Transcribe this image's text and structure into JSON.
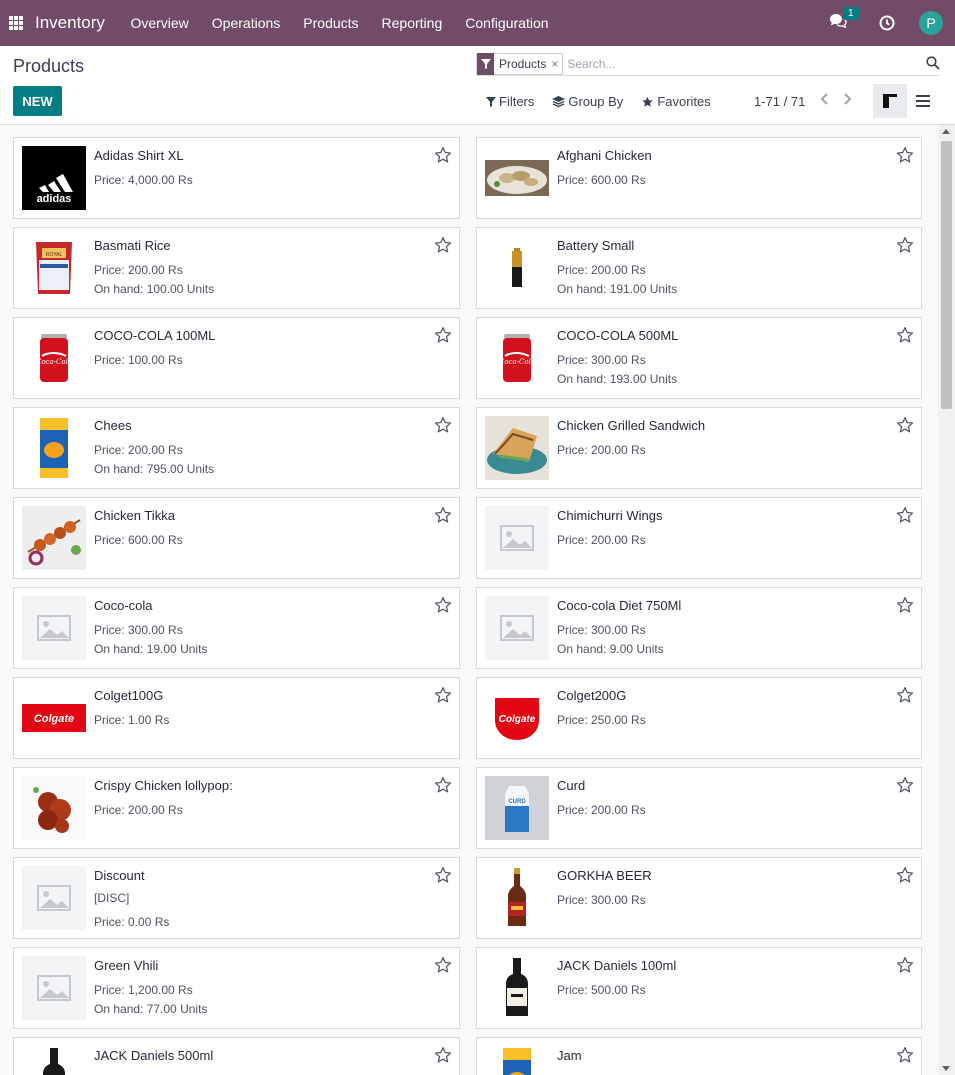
{
  "navbar": {
    "brand": "Inventory",
    "menu": [
      "Overview",
      "Operations",
      "Products",
      "Reporting",
      "Configuration"
    ],
    "chat_count": "1",
    "avatar_letter": "P",
    "color": "#714b67"
  },
  "control": {
    "title": "Products",
    "new_label": "NEW",
    "facet_value": "Products",
    "facet_close": "×",
    "search_placeholder": "Search...",
    "filters_label": "Filters",
    "groupby_label": "Group By",
    "favorites_label": "Favorites",
    "pager": "1-71 / 71",
    "active_view": "kanban"
  },
  "products": [
    {
      "name": "Adidas Shirt XL",
      "lines": [
        "Price: 4,000.00 Rs"
      ],
      "image": "adidas-logo"
    },
    {
      "name": "Afghani Chicken",
      "lines": [
        "Price: 600.00 Rs"
      ],
      "image": "food-plate"
    },
    {
      "name": "Basmati Rice",
      "lines": [
        "Price: 200.00 Rs",
        "On hand: 100.00 Units"
      ],
      "image": "rice-bag"
    },
    {
      "name": "Battery Small",
      "lines": [
        "Price: 200.00 Rs",
        "On hand: 191.00 Units"
      ],
      "image": "battery"
    },
    {
      "name": "COCO-COLA 100ML",
      "lines": [
        "Price: 100.00 Rs"
      ],
      "image": "cola-can"
    },
    {
      "name": "COCO-COLA 500ML",
      "lines": [
        "Price: 300.00 Rs",
        "On hand: 193.00 Units"
      ],
      "image": "cola-can"
    },
    {
      "name": "Chees",
      "lines": [
        "Price: 200.00 Rs",
        "On hand: 795.00 Units"
      ],
      "image": "cheese-box"
    },
    {
      "name": "Chicken Grilled Sandwich",
      "lines": [
        "Price: 200.00 Rs"
      ],
      "image": "sandwich"
    },
    {
      "name": "Chicken Tikka",
      "lines": [
        "Price: 600.00 Rs"
      ],
      "image": "tikka"
    },
    {
      "name": "Chimichurri Wings",
      "lines": [
        "Price: 200.00 Rs"
      ],
      "image": "placeholder"
    },
    {
      "name": "Coco-cola",
      "lines": [
        "Price: 300.00 Rs",
        "On hand: 19.00 Units"
      ],
      "image": "placeholder"
    },
    {
      "name": "Coco-cola Diet 750Ml",
      "lines": [
        "Price: 300.00 Rs",
        "On hand: 9.00 Units"
      ],
      "image": "placeholder"
    },
    {
      "name": "Colget100G",
      "lines": [
        "Price: 1.00 Rs"
      ],
      "image": "colgate-wide"
    },
    {
      "name": "Colget200G",
      "lines": [
        "Price: 250.00 Rs"
      ],
      "image": "colgate-round"
    },
    {
      "name": "Crispy Chicken lollypop:",
      "lines": [
        "Price: 200.00 Rs"
      ],
      "image": "lollypop"
    },
    {
      "name": "Curd",
      "lines": [
        "Price: 200.00 Rs"
      ],
      "image": "curd-carton"
    },
    {
      "name": "Discount",
      "lines": [
        "[DISC]",
        "Price: 0.00 Rs"
      ],
      "image": "placeholder"
    },
    {
      "name": "GORKHA BEER",
      "lines": [
        "Price: 300.00 Rs"
      ],
      "image": "beer-bottle"
    },
    {
      "name": "Green Vhili",
      "lines": [
        "Price: 1,200.00 Rs",
        "On hand: 77.00 Units"
      ],
      "image": "placeholder"
    },
    {
      "name": "JACK Daniels 100ml",
      "lines": [
        "Price: 500.00 Rs"
      ],
      "image": "whiskey-bottle"
    },
    {
      "name": "JACK Daniels 500ml",
      "lines": [],
      "image": "whiskey-bottle"
    },
    {
      "name": "Jam",
      "lines": [],
      "image": "cheese-box"
    }
  ],
  "colors": {
    "brand": "#714b67",
    "primary_button": "#017e84"
  }
}
